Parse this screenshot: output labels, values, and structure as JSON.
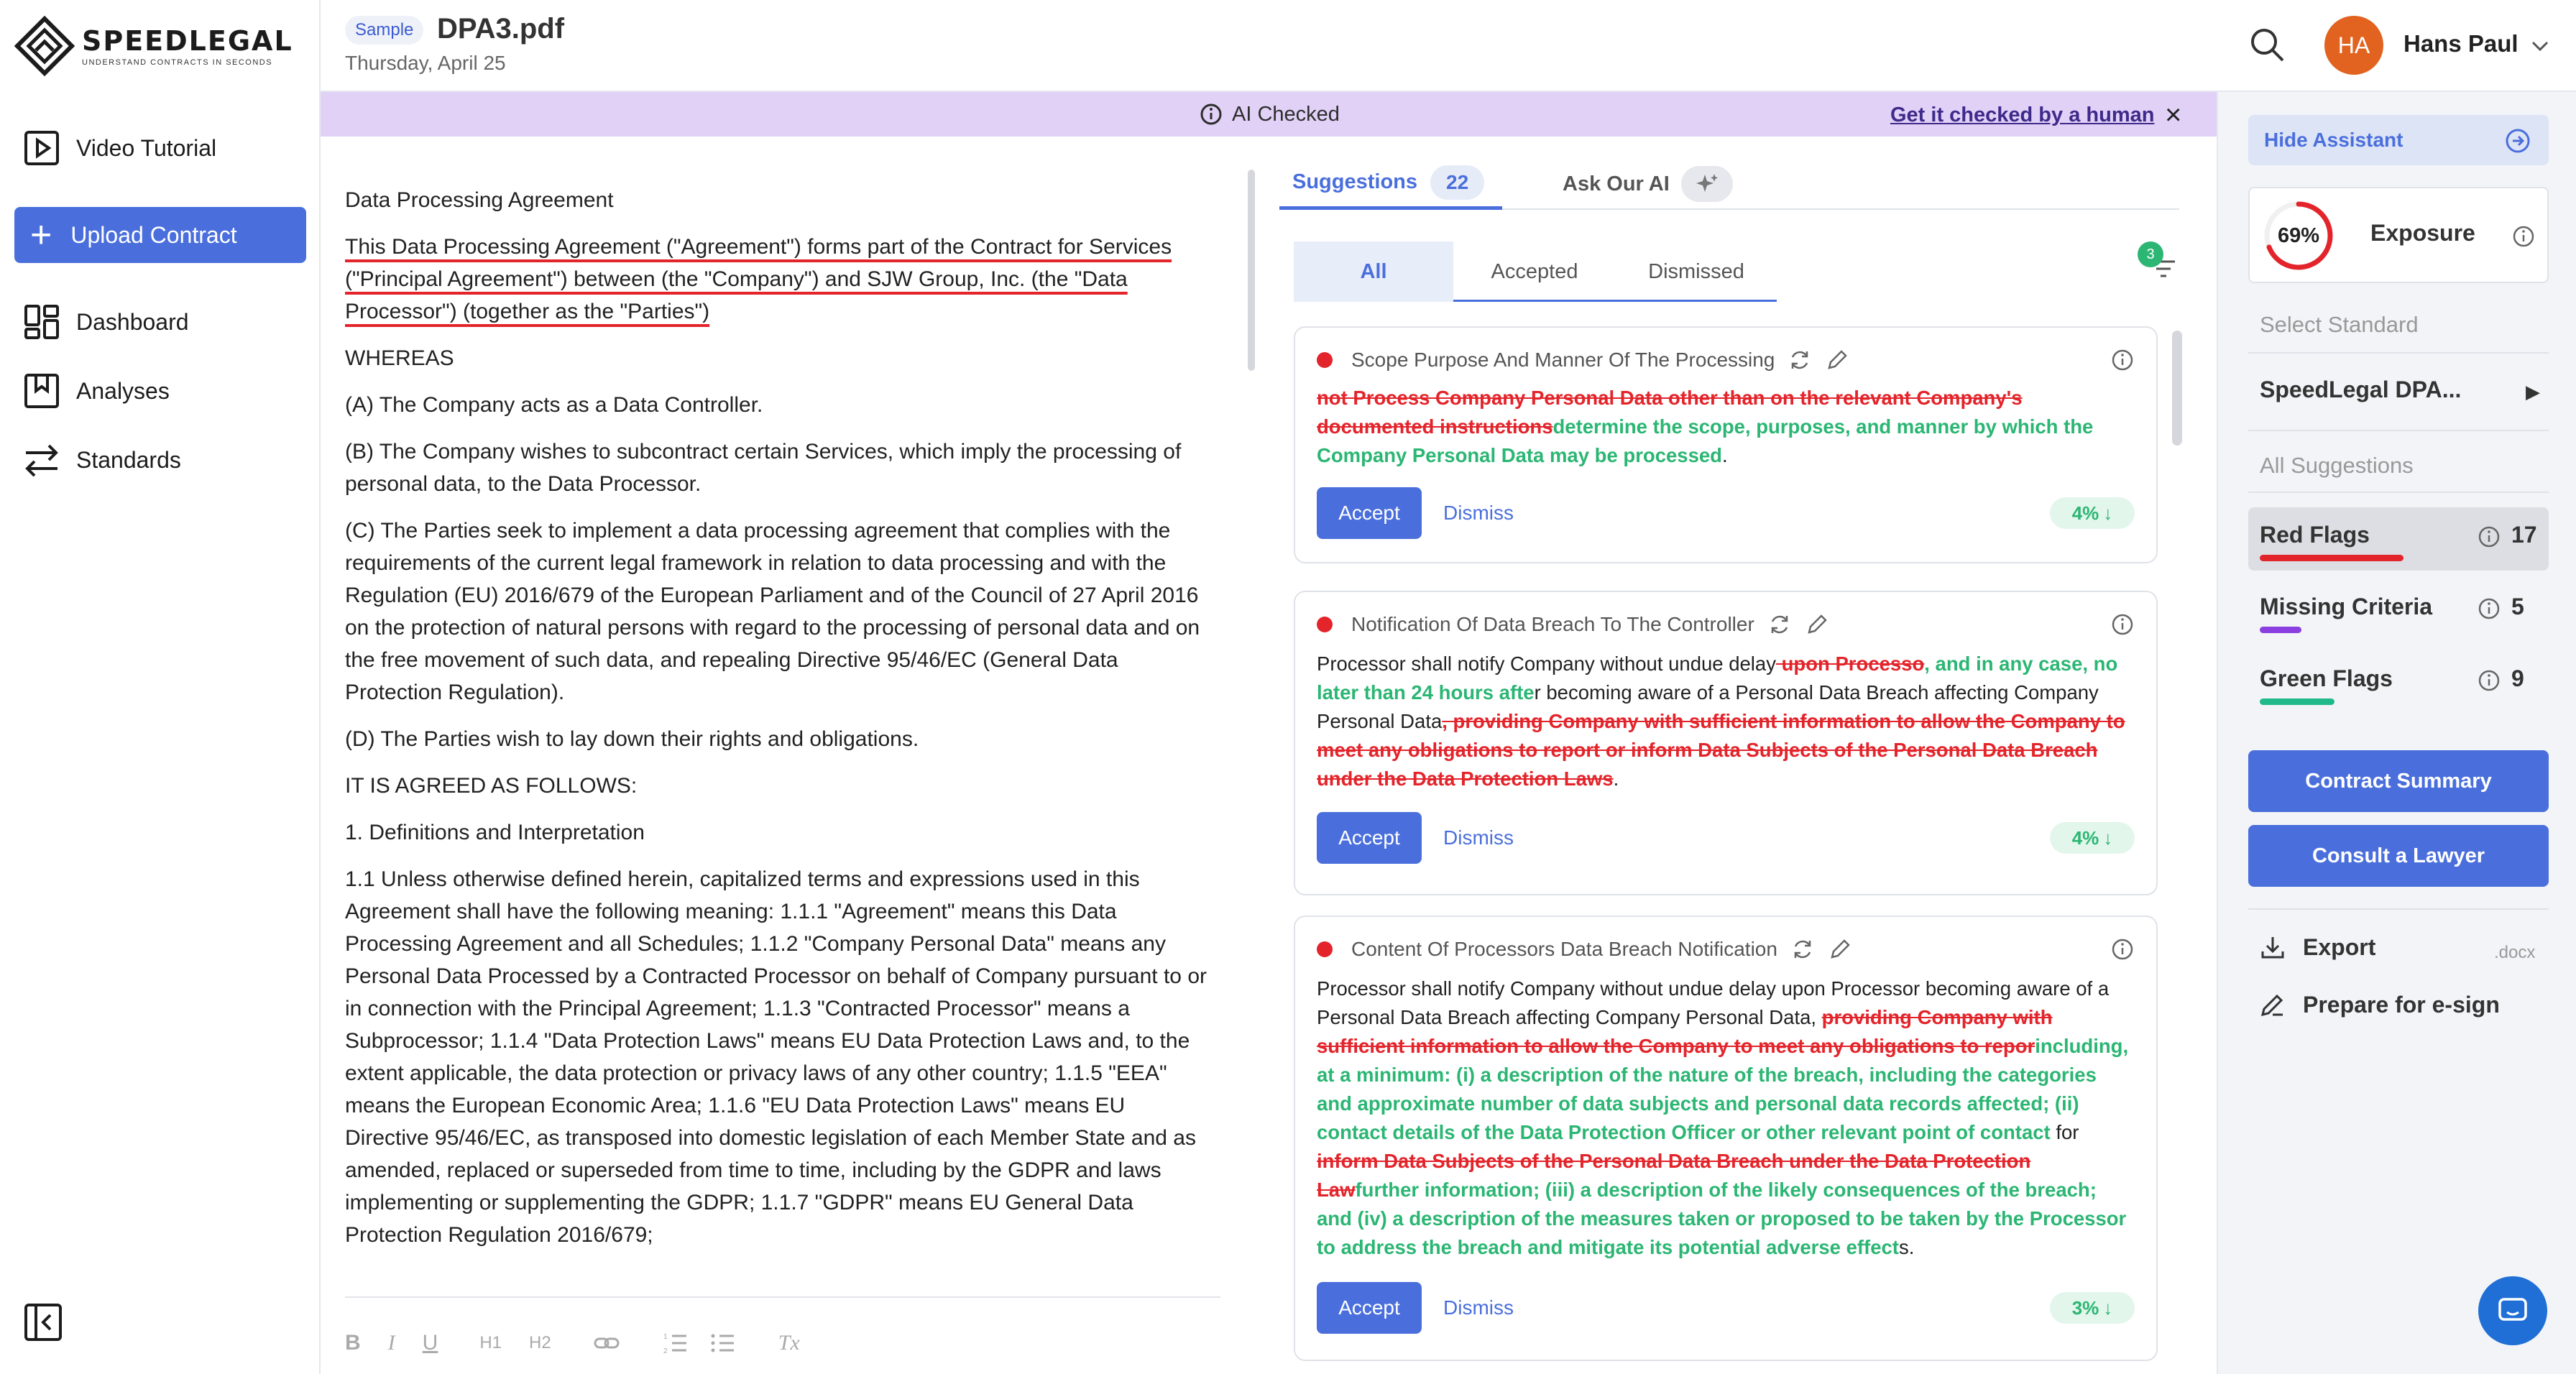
{
  "brand": {
    "name": "SPEEDLEGAL",
    "tagline": "UNDERSTAND CONTRACTS IN SECONDS"
  },
  "sidebar": {
    "items": [
      {
        "label": "Video Tutorial",
        "icon": "play-icon"
      },
      {
        "label": "Upload Contract",
        "icon": "plus-icon"
      },
      {
        "label": "Dashboard",
        "icon": "dashboard-icon"
      },
      {
        "label": "Analyses",
        "icon": "bookmark-icon"
      },
      {
        "label": "Standards",
        "icon": "arrows-icon"
      }
    ]
  },
  "header": {
    "badge": "Sample",
    "filename": "DPA3.pdf",
    "date": "Thursday, April 25",
    "user_initials": "HA",
    "user_name": "Hans Paul"
  },
  "banner": {
    "status": "AI Checked",
    "link": "Get it checked by a human",
    "close": "×"
  },
  "document": {
    "title": "Data Processing Agreement",
    "p1": "This Data Processing Agreement (\"Agreement\") forms part of the Contract for Services (\"Principal Agreement\") between (the \"Company\") and SJW Group, Inc. (the \"Data Processor\") (together as the \"Parties\")",
    "p2": "WHEREAS",
    "p3": "(A) The Company acts as a Data Controller.",
    "p4": "(B) The Company wishes to subcontract certain Services, which imply the processing of personal data, to the Data Processor.",
    "p5": "(C) The Parties seek to implement a data processing agreement that complies with the requirements of the current legal framework in relation to data processing and with the Regulation (EU) 2016/679 of the European Parliament and of the Council of 27 April 2016 on the protection of natural persons with regard to the processing of personal data and on the free movement of such data, and repealing Directive 95/46/EC (General Data Protection Regulation).",
    "p6": "(D) The Parties wish to lay down their rights and obligations.",
    "p7": "IT IS AGREED AS FOLLOWS:",
    "p8": "1. Definitions and Interpretation",
    "p9": "1.1 Unless otherwise defined herein, capitalized terms and expressions used in this Agreement shall have the following meaning: 1.1.1 \"Agreement\" means this Data Processing Agreement and all Schedules; 1.1.2 \"Company Personal Data\" means any Personal Data Processed by a Contracted Processor on behalf of Company pursuant to or in connection with the Principal Agreement; 1.1.3 \"Contracted Processor\" means a Subprocessor; 1.1.4 \"Data Protection Laws\" means EU Data Protection Laws and, to the extent applicable, the data protection or privacy laws of any other country; 1.1.5 \"EEA\" means the European Economic Area; 1.1.6 \"EU Data Protection Laws\" means EU Directive 95/46/EC, as transposed into domestic legislation of each Member State and as amended, replaced or superseded from time to time, including by the GDPR and laws implementing or supplementing the GDPR; 1.1.7 \"GDPR\" means EU General Data Protection Regulation 2016/679;",
    "toolbar": [
      "B",
      "I",
      "U",
      "H1",
      "H2",
      "link",
      "ol",
      "ul",
      "Tx"
    ]
  },
  "suggestions": {
    "tab_label": "Suggestions",
    "count": "22",
    "ai_tab": "Ask Our AI",
    "filters": [
      "All",
      "Accepted",
      "Dismissed"
    ],
    "sort_badge": "3",
    "accept": "Accept",
    "dismiss": "Dismiss",
    "cards": [
      {
        "title": "Scope Purpose And Manner Of The Processing",
        "del1": "not Process Company Personal Data other than on the relevant Company's documented instructions",
        "ins1": "determine the scope, purposes, and manner by which the Company Personal Data may be processed",
        "tail": ".",
        "pct": "4%"
      },
      {
        "title": "Notification Of Data Breach To The Controller",
        "t1": "Processor shall notify Company without undue delay",
        "del1": " upon Processo",
        "ins1": ", and in any case, no later than 24 hours afte",
        "t2": "r becoming aware of a Personal Data Breach affecting Company Personal Data",
        "del2": ", providing Company with sufficient information to allow the Company to meet any obligations to report or inform Data Subjects of the Personal Data Breach under the Data Protection Laws",
        "tail": ".",
        "pct": "4%"
      },
      {
        "title": "Content Of Processors Data Breach Notification",
        "t1": "Processor shall notify Company without undue delay upon Processor becoming aware of a Personal Data Breach affecting Company Personal Data, ",
        "del1": "providing Company with sufficient information to allow the Company to meet any obligations to repor",
        "ins1": "including, at a minimum: (i) a description of the nature of the breach, including the categories and approximate number of data subjects and personal data records affected; (ii) contact details of the Data Protection Officer or other relevant point of contact ",
        "t2": "for ",
        "del2": "inform Data Subjects of the Personal Data Breach under the Data Protection Law",
        "ins2": "further information; (iii) a description of the likely consequences of the breach; and (iv) a description of the measures taken or proposed to be taken by the Processor to address the breach and mitigate its potential adverse effect",
        "tail": "s.",
        "pct": "3%"
      }
    ]
  },
  "assistant": {
    "hide": "Hide Assistant",
    "exposure_value": "69%",
    "exposure_fraction": 0.69,
    "exposure_label": "Exposure",
    "select_standard": "Select Standard",
    "standard": "SpeedLegal DPA...",
    "all_suggestions": "All Suggestions",
    "flags": [
      {
        "name": "Red Flags",
        "count": "17",
        "color": "#e3242b"
      },
      {
        "name": "Missing Criteria",
        "count": "5",
        "color": "#8b3fe0"
      },
      {
        "name": "Green Flags",
        "count": "9",
        "color": "#1fb98a"
      }
    ],
    "summary": "Contract Summary",
    "lawyer": "Consult a Lawyer",
    "export": "Export",
    "export_ext": ".docx",
    "esign": "Prepare for e-sign"
  },
  "colors": {
    "accent": "#4a6fdc",
    "danger": "#e3242b",
    "success": "#2bb673",
    "banner": "#e1d1f7"
  }
}
